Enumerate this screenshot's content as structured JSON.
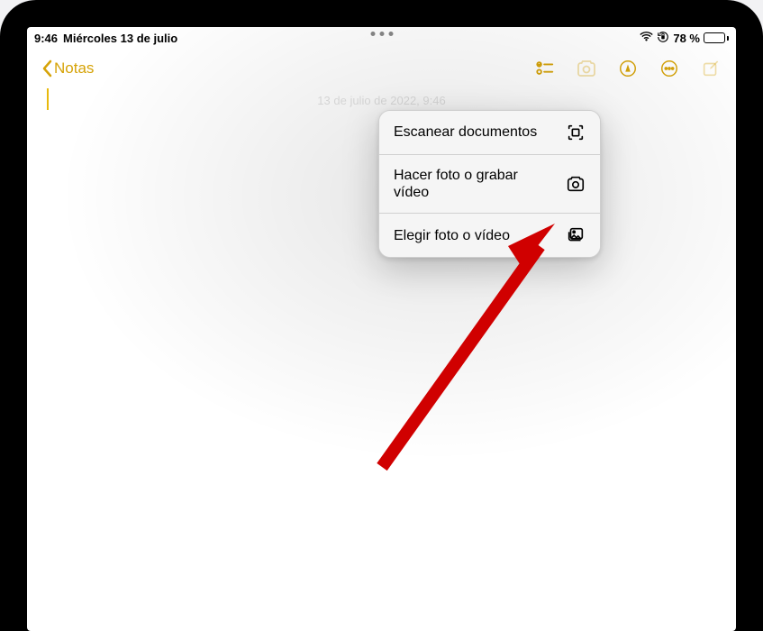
{
  "status": {
    "time": "9:46",
    "date": "Miércoles 13 de julio",
    "battery_pct": "78 %"
  },
  "toolbar": {
    "back_label": "Notas"
  },
  "note": {
    "timestamp": "13 de julio de 2022, 9:46"
  },
  "popover": {
    "items": [
      {
        "label": "Escanear documentos",
        "icon": "scan-icon"
      },
      {
        "label": "Hacer foto o grabar vídeo",
        "icon": "camera-icon"
      },
      {
        "label": "Elegir foto o vídeo",
        "icon": "gallery-icon"
      }
    ]
  }
}
